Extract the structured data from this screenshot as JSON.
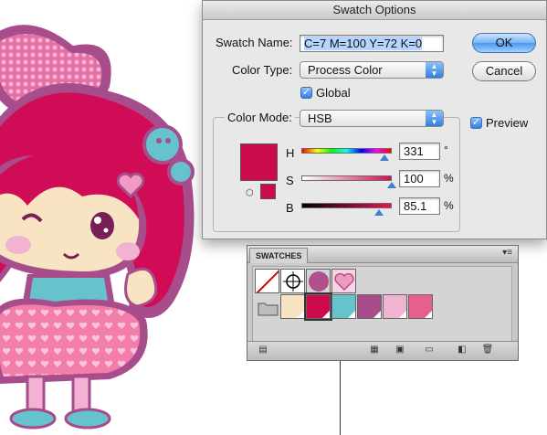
{
  "dialog": {
    "title": "Swatch Options",
    "swatch_name_label": "Swatch Name:",
    "swatch_name_value": "C=7 M=100 Y=72 K=0",
    "color_type_label": "Color Type:",
    "color_type_value": "Process Color",
    "global_label": "Global",
    "global_checked": true,
    "color_mode_label": "Color Mode:",
    "color_mode_value": "HSB",
    "preview_label": "Preview",
    "preview_checked": true,
    "ok_label": "OK",
    "cancel_label": "Cancel",
    "current_color": "#cc0a4e",
    "channels": [
      {
        "name": "H",
        "value": "331",
        "unit": "°",
        "fraction": 0.92
      },
      {
        "name": "S",
        "value": "100",
        "unit": "%",
        "fraction": 1.0
      },
      {
        "name": "B",
        "value": "85.1",
        "unit": "%",
        "fraction": 0.851
      }
    ]
  },
  "panel": {
    "tab_label": "SWATCHES",
    "row1": [
      {
        "kind": "none",
        "icon": "none-swatch-icon"
      },
      {
        "kind": "registration",
        "icon": "registration-target-icon"
      },
      {
        "kind": "pattern",
        "color": "#b34e8c",
        "icon": "circle-pattern-icon"
      },
      {
        "kind": "pattern",
        "color": "#f19ac4",
        "icon": "heart-pattern-icon"
      }
    ],
    "row2": [
      {
        "kind": "folder",
        "icon": "color-group-folder-icon"
      },
      {
        "kind": "color",
        "color": "#f8e3c3"
      },
      {
        "kind": "color",
        "color": "#cc0a4e",
        "selected": true
      },
      {
        "kind": "color",
        "color": "#66c2cc"
      },
      {
        "kind": "color",
        "color": "#a84d8c"
      },
      {
        "kind": "color",
        "color": "#f2b3d2"
      },
      {
        "kind": "color",
        "color": "#e5608f"
      }
    ],
    "bottom_icons": [
      "swatch-libraries-icon",
      "show-kinds-icon",
      "swatch-options-icon",
      "new-color-group-icon",
      "new-swatch-icon",
      "delete-swatch-icon"
    ]
  }
}
